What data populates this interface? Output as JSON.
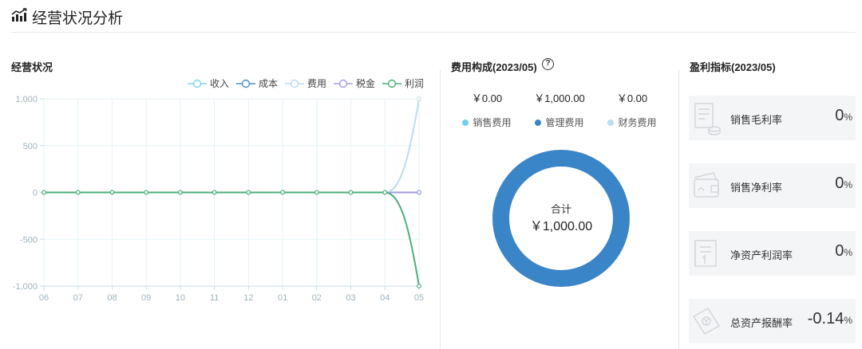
{
  "header": {
    "title": "经营状况分析",
    "icon": "bar-chart-trend-icon"
  },
  "business": {
    "title": "经营状况",
    "chart_data": {
      "type": "line",
      "title": "",
      "categories": [
        "06",
        "07",
        "08",
        "09",
        "10",
        "11",
        "12",
        "01",
        "02",
        "03",
        "04",
        "05"
      ],
      "ylim": [
        -1000,
        1000
      ],
      "yticks": [
        1000,
        500,
        0,
        -500,
        -1000
      ],
      "ytick_labels": [
        "1,000",
        "500",
        "0",
        "-500",
        "-1,000"
      ],
      "legend_position": "top-right",
      "grid": true,
      "series": [
        {
          "name": "收入",
          "color": "#7fd6ea",
          "values": [
            0,
            0,
            0,
            0,
            0,
            0,
            0,
            0,
            0,
            0,
            0,
            0
          ]
        },
        {
          "name": "成本",
          "color": "#4a8cc9",
          "values": [
            0,
            0,
            0,
            0,
            0,
            0,
            0,
            0,
            0,
            0,
            0,
            0
          ]
        },
        {
          "name": "费用",
          "color": "#bcdcef",
          "values": [
            0,
            0,
            0,
            0,
            0,
            0,
            0,
            0,
            0,
            0,
            0,
            1000
          ]
        },
        {
          "name": "税金",
          "color": "#a59be0",
          "values": [
            0,
            0,
            0,
            0,
            0,
            0,
            0,
            0,
            0,
            0,
            0,
            0
          ]
        },
        {
          "name": "利润",
          "color": "#4cb07a",
          "values": [
            0,
            0,
            0,
            0,
            0,
            0,
            0,
            0,
            0,
            0,
            0,
            -1000
          ]
        }
      ]
    }
  },
  "cost": {
    "title": "费用构成(2023/05)",
    "help_icon": "question-circle-icon",
    "help_glyph": "?",
    "items": [
      {
        "value": "￥0.00",
        "label": "销售费用",
        "color": "#6fd0ef"
      },
      {
        "value": "￥1,000.00",
        "label": "管理费用",
        "color": "#3a85c8"
      },
      {
        "value": "￥0.00",
        "label": "财务费用",
        "color": "#bcdcef"
      }
    ],
    "donut": {
      "label": "合计",
      "value": "￥1,000.00",
      "color": "#3a85c8",
      "chart_data": {
        "type": "pie",
        "categories": [
          "销售费用",
          "管理费用",
          "财务费用"
        ],
        "values": [
          0,
          1000,
          0
        ]
      }
    }
  },
  "profit": {
    "title": "盈利指标(2023/05)",
    "unit": "%",
    "items": [
      {
        "label": "销售毛利率",
        "value": "0",
        "icon": "receipt-coins-icon"
      },
      {
        "label": "销售净利率",
        "value": "0",
        "icon": "wallet-card-icon"
      },
      {
        "label": "净资产利润率",
        "value": "0",
        "icon": "ledger-book-icon"
      },
      {
        "label": "总资产报酬率",
        "value": "-0.14",
        "icon": "money-stamp-icon"
      }
    ]
  }
}
